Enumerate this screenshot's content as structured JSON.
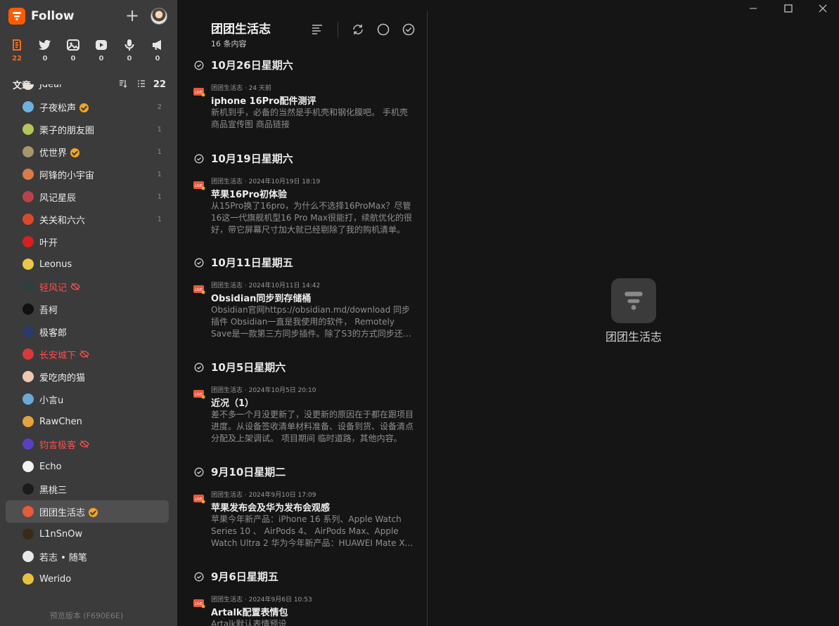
{
  "app": {
    "name": "Follow",
    "version": "预览版本 (F690E6E)"
  },
  "colors": {
    "accent": "#ff5c00",
    "error": "#ff4d4d",
    "verified": "#f5a524"
  },
  "views": [
    {
      "icon": "article-icon",
      "count": "22"
    },
    {
      "icon": "twitter-icon",
      "count": "0"
    },
    {
      "icon": "picture-icon",
      "count": "0"
    },
    {
      "icon": "video-icon",
      "count": "0"
    },
    {
      "icon": "microphone-icon",
      "count": "0"
    },
    {
      "icon": "megaphone-icon",
      "count": "0"
    }
  ],
  "section": {
    "title": "文章",
    "total": "22"
  },
  "feeds": [
    {
      "name": "Jdeal",
      "count": "2",
      "verified": false,
      "error": false,
      "color": "#e9e3d3"
    },
    {
      "name": "子夜松声",
      "count": "2",
      "verified": true,
      "error": false,
      "color": "#6db2df"
    },
    {
      "name": "栗子的朋友圈",
      "count": "1",
      "verified": false,
      "error": false,
      "color": "#b6c55a"
    },
    {
      "name": "优世界",
      "count": "1",
      "verified": true,
      "error": false,
      "color": "#a8956d"
    },
    {
      "name": "阿锋的小宇宙",
      "count": "1",
      "verified": false,
      "error": false,
      "color": "#d97a4a"
    },
    {
      "name": "风记星辰",
      "count": "1",
      "verified": false,
      "error": false,
      "color": "#b8434b"
    },
    {
      "name": "关关和六六",
      "count": "1",
      "verified": false,
      "error": false,
      "color": "#d84a2e"
    },
    {
      "name": "叶开",
      "count": "",
      "verified": false,
      "error": false,
      "color": "#d81f1f"
    },
    {
      "name": "Leonus",
      "count": "",
      "verified": false,
      "error": false,
      "color": "#e8c84a"
    },
    {
      "name": "轻风记",
      "count": "",
      "verified": false,
      "error": true,
      "color": "#2f3f3f"
    },
    {
      "name": "吾柯",
      "count": "",
      "verified": false,
      "error": false,
      "color": "#111111"
    },
    {
      "name": "极客郎",
      "count": "",
      "verified": false,
      "error": false,
      "color": "#2a3a6a"
    },
    {
      "name": "长安城下",
      "count": "",
      "verified": false,
      "error": true,
      "color": "#d83a3a"
    },
    {
      "name": "爱吃肉的猫",
      "count": "",
      "verified": false,
      "error": false,
      "color": "#f0c8b0"
    },
    {
      "name": "小言u",
      "count": "",
      "verified": false,
      "error": false,
      "color": "#6aa9d8"
    },
    {
      "name": "RawChen",
      "count": "",
      "verified": false,
      "error": false,
      "color": "#e6a23c"
    },
    {
      "name": "钧言极客",
      "count": "",
      "verified": false,
      "error": true,
      "color": "#5a3fbf"
    },
    {
      "name": "Echo",
      "count": "",
      "verified": false,
      "error": false,
      "color": "#f2f2f2"
    },
    {
      "name": "黑桃三",
      "count": "",
      "verified": false,
      "error": false,
      "color": "#1b1b1b"
    },
    {
      "name": "团团生活志",
      "count": "",
      "verified": true,
      "error": false,
      "color": "#e85a3a",
      "active": true
    },
    {
      "name": "L1nSnOw",
      "count": "",
      "verified": false,
      "error": false,
      "color": "#3a2a1a"
    },
    {
      "name": "若志 • 随笔",
      "count": "",
      "verified": false,
      "error": false,
      "color": "#e8e8e8"
    },
    {
      "name": "Werido",
      "count": "",
      "verified": false,
      "error": false,
      "color": "#e8c040"
    }
  ],
  "entry_column": {
    "title": "团团生活志",
    "subtitle": "16 条内容",
    "tools": [
      "filter-icon",
      "refresh-icon",
      "unread-circle-icon",
      "mark-all-read-icon"
    ]
  },
  "days": [
    {
      "label": "10月26日星期六",
      "entries": [
        {
          "source": "团团生活志",
          "time": "24 天前",
          "title": "iphone 16Pro配件测评",
          "desc": "新机到手，必备的当然是手机壳和钢化膜吧。 手机壳 商品宣传图 商品链接"
        }
      ]
    },
    {
      "label": "10月19日星期六",
      "entries": [
        {
          "source": "团团生活志",
          "time": "2024年10月19日 18:19",
          "title": "苹果16Pro初体验",
          "desc": "从15Pro换了16pro，为什么不选择16ProMax？尽管16这一代旗舰机型16 Pro Max很能打，续航优化的很好，带它屏幕尺寸加大就已经剔除了我的购机清单。"
        }
      ]
    },
    {
      "label": "10月11日星期五",
      "entries": [
        {
          "source": "团团生活志",
          "time": "2024年10月11日 14:42",
          "title": "Obsidian同步到存储桶",
          "desc": "Obsidian官网https://obsidian.md/download 同步插件 Obsidian一直是我使用的软件， Remotely Save是一款第三方同步插件。除了S3的方式同步还有其他方式。"
        }
      ]
    },
    {
      "label": "10月5日星期六",
      "entries": [
        {
          "source": "团团生活志",
          "time": "2024年10月5日 20:10",
          "title": "近况（1）",
          "desc": "差不多一个月没更新了，没更新的原因在于都在跟项目进度。从设备签收清单材料准备、设备到货、设备清点分配及上架调试。 项目期间 临时道路，其他内容。"
        }
      ]
    },
    {
      "label": "9月10日星期二",
      "entries": [
        {
          "source": "团团生活志",
          "time": "2024年9月10日 17:09",
          "title": "苹果发布会及华为发布会观感",
          "desc": "苹果今年新产品：iPhone 16 系列、Apple Watch Series 10 、 AirPods 4、 AirPods Max、Apple Watch Ultra 2 华为今年新产品：HUAWEI Mate XT 非凡大师。"
        }
      ]
    },
    {
      "label": "9月6日星期五",
      "entries": [
        {
          "source": "团团生活志",
          "time": "2024年9月6日 10:53",
          "title": "Artalk配置表情包",
          "desc": "Artalk默认表情预设"
        }
      ]
    }
  ],
  "content": {
    "placeholder_name": "团团生活志"
  }
}
